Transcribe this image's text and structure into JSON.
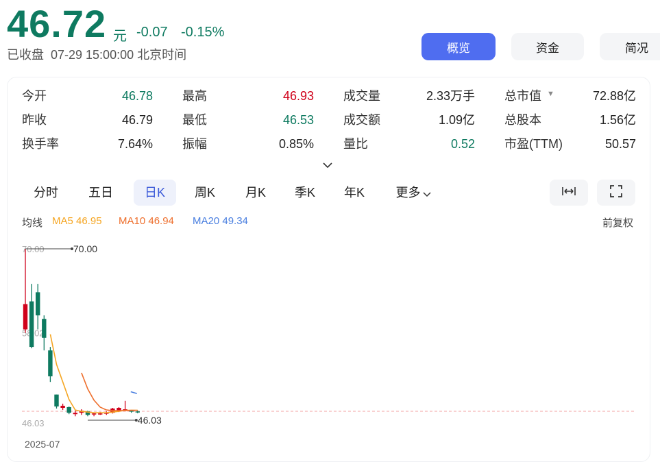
{
  "header": {
    "price": "46.72",
    "unit": "元",
    "change": "-0.07",
    "change_pct": "-0.15%",
    "status": "已收盘  07-29 15:00:00 北京时间"
  },
  "nav_buttons": [
    {
      "label": "概览",
      "active": true
    },
    {
      "label": "资金",
      "active": false
    },
    {
      "label": "简况",
      "active": false
    }
  ],
  "stats": [
    [
      {
        "label": "今开",
        "value": "46.78",
        "color": "down"
      },
      {
        "label": "最高",
        "value": "46.93",
        "color": "up"
      },
      {
        "label": "成交量",
        "value": "2.33万手",
        "color": ""
      },
      {
        "label": "总市值",
        "value": "72.88亿",
        "color": "",
        "has_caret": true
      }
    ],
    [
      {
        "label": "昨收",
        "value": "46.79",
        "color": ""
      },
      {
        "label": "最低",
        "value": "46.53",
        "color": "down"
      },
      {
        "label": "成交额",
        "value": "1.09亿",
        "color": ""
      },
      {
        "label": "总股本",
        "value": "1.56亿",
        "color": ""
      }
    ],
    [
      {
        "label": "换手率",
        "value": "7.64%",
        "color": ""
      },
      {
        "label": "振幅",
        "value": "0.85%",
        "color": ""
      },
      {
        "label": "量比",
        "value": "0.52",
        "color": "down"
      },
      {
        "label": "市盈(TTM)",
        "value": "50.57",
        "color": ""
      }
    ]
  ],
  "tabs": [
    "分时",
    "五日",
    "日K",
    "周K",
    "月K",
    "季K",
    "年K",
    "更多"
  ],
  "active_tab": "日K",
  "ma_legend": {
    "label": "均线",
    "ma5": "MA5 46.95",
    "ma10": "MA10 46.94",
    "ma20": "MA20 49.34",
    "ma5_color": "#f5a623",
    "ma10_color": "#ee6f2d",
    "ma20_color": "#4a7fe0",
    "adjust": "前复权"
  },
  "chart_data": {
    "type": "candlestick",
    "xlabel_start": "2025-07",
    "y_ticks": [
      "70.00",
      "58.02",
      "46.03"
    ],
    "ylim": [
      46.03,
      70.0
    ],
    "max_annotation": "70.00",
    "min_annotation": "46.03",
    "up_color": "#d0021b",
    "down_color": "#0e7a60",
    "candles": [
      {
        "o": 58.5,
        "c": 62.1,
        "h": 70.0,
        "l": 58.0
      },
      {
        "o": 62.5,
        "c": 56.0,
        "h": 65.0,
        "l": 55.8
      },
      {
        "o": 63.8,
        "c": 60.5,
        "h": 65.0,
        "l": 58.5
      },
      {
        "o": 60.0,
        "c": 57.3,
        "h": 60.5,
        "l": 55.5
      },
      {
        "o": 55.5,
        "c": 51.8,
        "h": 56.0,
        "l": 51.0
      },
      {
        "o": 49.2,
        "c": 47.5,
        "h": 49.2,
        "l": 47.2
      },
      {
        "o": 47.3,
        "c": 47.6,
        "h": 47.9,
        "l": 47.0
      },
      {
        "o": 47.4,
        "c": 46.6,
        "h": 47.5,
        "l": 46.4
      },
      {
        "o": 46.4,
        "c": 46.6,
        "h": 46.9,
        "l": 46.1
      },
      {
        "o": 46.6,
        "c": 46.9,
        "h": 47.1,
        "l": 46.3
      },
      {
        "o": 46.8,
        "c": 46.3,
        "h": 46.9,
        "l": 46.1
      },
      {
        "o": 46.4,
        "c": 46.5,
        "h": 46.6,
        "l": 46.1
      },
      {
        "o": 46.5,
        "c": 46.5,
        "h": 46.7,
        "l": 46.3
      },
      {
        "o": 46.5,
        "c": 46.6,
        "h": 46.8,
        "l": 46.3
      },
      {
        "o": 46.6,
        "c": 47.2,
        "h": 47.3,
        "l": 46.5
      },
      {
        "o": 46.8,
        "c": 47.3,
        "h": 47.4,
        "l": 46.7
      },
      {
        "o": 47.0,
        "c": 47.1,
        "h": 48.3,
        "l": 46.8
      },
      {
        "o": 46.9,
        "c": 46.8,
        "h": 47.0,
        "l": 46.6
      },
      {
        "o": 46.79,
        "c": 46.72,
        "h": 46.93,
        "l": 46.53
      }
    ],
    "ma5": [
      null,
      null,
      null,
      null,
      57.8,
      53.5,
      51.0,
      48.5,
      47.0,
      46.8,
      46.7,
      46.6,
      46.6,
      46.6,
      46.7,
      46.8,
      46.95,
      46.95,
      46.95
    ],
    "ma10": [
      null,
      null,
      null,
      null,
      null,
      null,
      null,
      null,
      null,
      52.3,
      50.0,
      48.4,
      47.4,
      47.0,
      46.9,
      46.9,
      46.9,
      46.95,
      46.94
    ],
    "ma20_tail": [
      49.6,
      49.34
    ]
  }
}
